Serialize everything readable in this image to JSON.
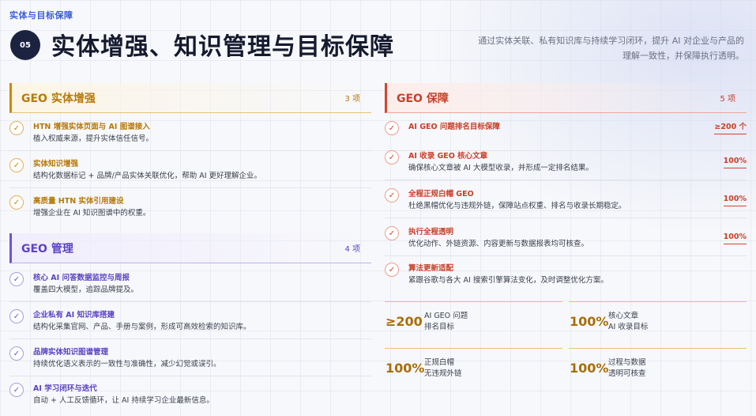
{
  "header": {
    "kicker": "实体与目标保障",
    "section_number": "05",
    "title": "实体增强、知识管理与目标保障",
    "subtitle": "通过实体关联、私有知识库与持续学习闭环，提升 AI 对企业与产品的理解一致性，并保障执行透明。"
  },
  "colors": {
    "orange": "#c88a12",
    "purple": "#6d55d6",
    "red": "#d2452f",
    "dark": "#1c2340"
  },
  "sections": {
    "entity": {
      "title": "GEO 实体增强",
      "count": "3 项",
      "items": [
        {
          "title": "HTN 增强实体页面与 AI 图谱接入",
          "desc": "植入权威来源，提升实体信任信号。"
        },
        {
          "title": "实体知识增强",
          "desc": "结构化数据标记 + 品牌/产品实体关联优化，帮助 AI 更好理解企业。"
        },
        {
          "title": "高质量 HTN 实体引用建设",
          "desc": "增强企业在 AI 知识图谱中的权重。"
        }
      ]
    },
    "management": {
      "title": "GEO 管理",
      "count": "4 项",
      "items": [
        {
          "title": "核心 AI 问答数据监控与周报",
          "desc": "覆盖四大模型，追踪品牌提及。"
        },
        {
          "title": "企业私有 AI 知识库搭建",
          "desc": "结构化采集官网、产品、手册与案例，形成可高效检索的知识库。"
        },
        {
          "title": "品牌实体知识图谱管理",
          "desc": "持续优化语义表示的一致性与准确性，减少幻觉或误引。"
        },
        {
          "title": "AI 学习闭环与迭代",
          "desc": "自动 + 人工反馈循环，让 AI 持续学习企业最新信息。"
        }
      ]
    },
    "guarantee": {
      "title": "GEO 保障",
      "count": "5 项",
      "items": [
        {
          "title": "AI GEO 问题排名目标保障",
          "desc": "",
          "value": "≥200 个"
        },
        {
          "title": "AI 收录 GEO 核心文章",
          "desc": "确保核心文章被 AI 大模型收录，并形成一定排名结果。",
          "value": "100%"
        },
        {
          "title": "全程正规白帽 GEO",
          "desc": "杜绝黑帽优化与违规外链，保障站点权重、排名与收录长期稳定。",
          "value": "100%"
        },
        {
          "title": "执行全程透明",
          "desc": "优化动作、外链资源、内容更新与数据报表均可核查。",
          "value": "100%"
        },
        {
          "title": "算法更新适配",
          "desc": "紧跟谷歌与各大 AI 搜索引擎算法变化，及时调整优化方案。",
          "value": ""
        }
      ]
    }
  },
  "stats": [
    {
      "value": "≥200",
      "label1": "AI GEO 问题",
      "label2": "排名目标"
    },
    {
      "value": "100%",
      "label1": "核心文章",
      "label2": "AI 收录目标"
    },
    {
      "value": "100%",
      "label1": "正规白帽",
      "label2": "无违规外链"
    },
    {
      "value": "100%",
      "label1": "过程与数据",
      "label2": "透明可核查"
    }
  ],
  "check_glyph": "✓"
}
